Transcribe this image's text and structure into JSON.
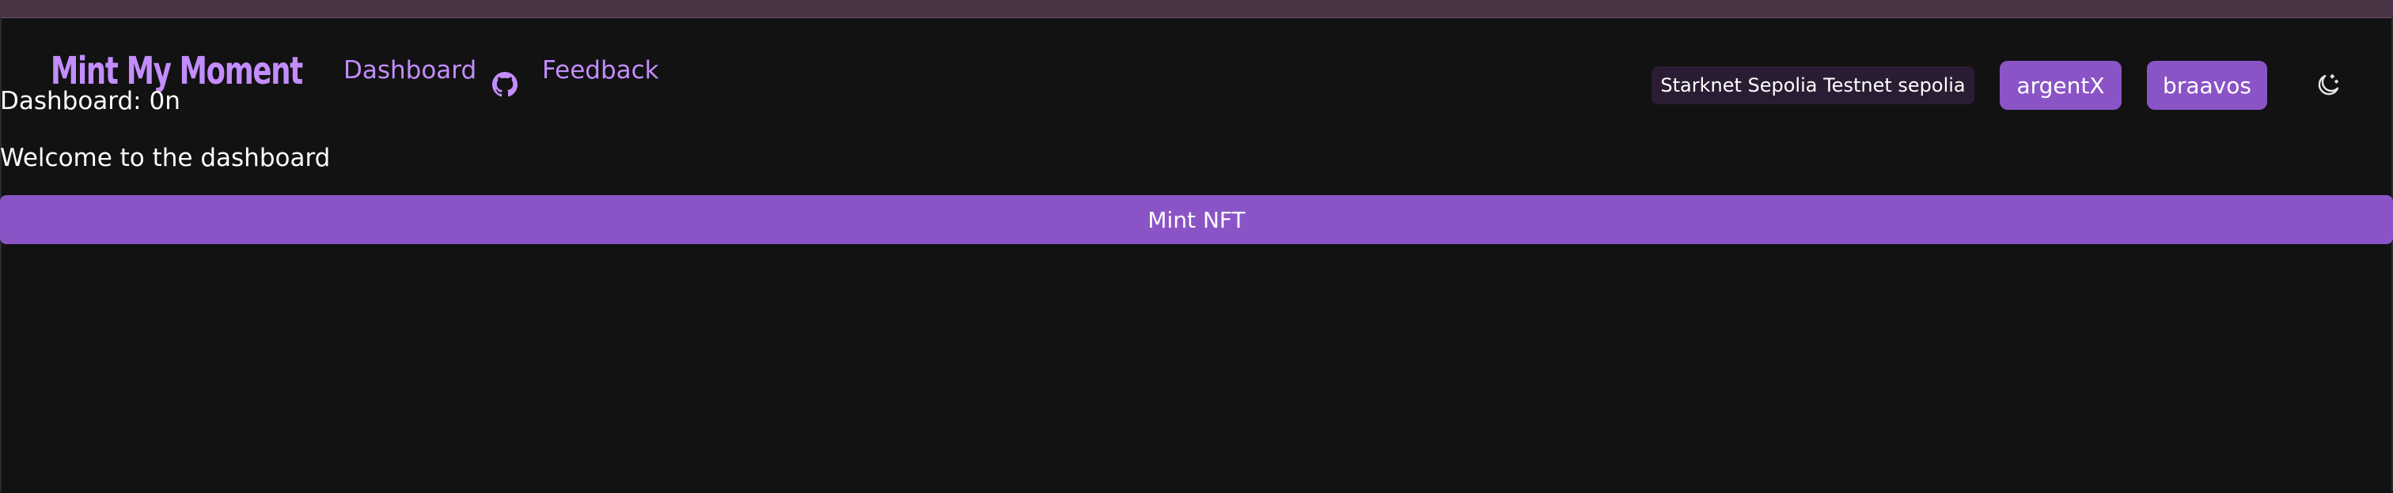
{
  "colors": {
    "background": "#121212",
    "accent": "#c38dff",
    "button": "#8a54c6",
    "badge_bg": "#2a1d33",
    "topbar": "#4a3546"
  },
  "navbar": {
    "brand": "Mint My Moment",
    "links": {
      "dashboard": "Dashboard",
      "github_icon": "github-icon",
      "feedback": "Feedback"
    },
    "network_badge": "Starknet Sepolia Testnet sepolia",
    "wallets": {
      "argentx": "argentX",
      "braavos": "braavos"
    },
    "theme_toggle_icon": "moon-icon"
  },
  "main": {
    "title": "Dashboard: 0n",
    "welcome": "Welcome to the dashboard",
    "mint_button": "Mint NFT"
  }
}
